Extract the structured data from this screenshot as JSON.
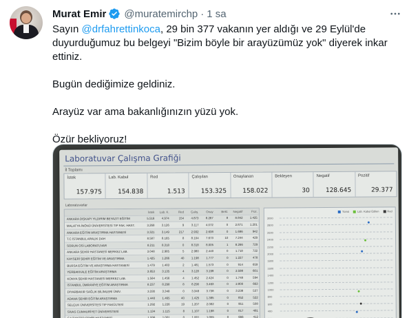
{
  "tweet": {
    "author_name": "Murat Emir",
    "handle": "@muratemirchp",
    "separator": "·",
    "time": "1 sa",
    "icons": {
      "verified": "verified-badge-icon",
      "more": "more-options-icon"
    },
    "colors": {
      "accent": "#1d9bf0",
      "text": "#0f1419",
      "secondary": "#536471"
    },
    "text": {
      "p1_before_mention": "Sayın ",
      "p1_mention": "@drfahrettinkoca",
      "p1_after_mention": ", 29 bin 377 vakanın yer aldığı ve 29 Eylül'de duyurduğumuz bu belgeyi \"Bizim böyle bir arayüzümüz yok\" diyerek inkar ettiniz.",
      "p2": "Bugün dediğimize geldiniz.",
      "p3": "Arayüz var ama bakanlığınızın yüzü yok.",
      "p4": "Özür bekliyoruz!"
    }
  },
  "media": {
    "paper_title": "Laboratuvar Çalışma Grafiği",
    "context_label": "İl Toplamı",
    "kpis": [
      {
        "label": "İstek",
        "value": "157.975"
      },
      {
        "label": "Lab. Kabul",
        "value": "154.838"
      },
      {
        "label": "Red",
        "value": "1.513"
      },
      {
        "label": "Çalışılan",
        "value": "153.325"
      },
      {
        "label": "Onaylanan",
        "value": "158.022"
      },
      {
        "label": "Bekleyen",
        "value": "30"
      },
      {
        "label": "Negatif",
        "value": "128.645"
      },
      {
        "label": "Pozitif",
        "value": "29.377"
      }
    ],
    "table_label": "Laboratuvarlar",
    "table_headers": [
      "",
      "İstek",
      "Lab. K.",
      "Red",
      "Çalış.",
      "Onay",
      "Bekl.",
      "Negatif",
      "Poz."
    ],
    "table_rows": [
      [
        "ANKARA DIŞKAPI YILDIRIM BEYAZIT EĞİTİM",
        "5.516",
        "4.974",
        "154",
        "4.873",
        "8.267",
        "8",
        "8.842",
        "1.425"
      ],
      [
        "MALATYA İNÖNÜ ÜNİVERSİTESİ TIP FAK. HAST.",
        "3.268",
        "3.126",
        "9",
        "3.117",
        "4.072",
        "0",
        "2.871",
        "1.201"
      ],
      [
        "ANKARA EĞİTİM ARAŞTIRMA HASTANESİ",
        "3.321",
        "3.149",
        "217",
        "2.932",
        "2.638",
        "0",
        "1.696",
        "942"
      ],
      [
        "T.C İSTANBUL ARALIK DAH",
        "8.587",
        "8.165",
        "8",
        "8.104",
        "7.673",
        "10",
        "7.244",
        "429"
      ],
      [
        "SORUN OSİ LABORATUVAR",
        "8.211",
        "8.318",
        "0",
        "8.318",
        "8.005",
        "1",
        "8.266",
        "729"
      ],
      [
        "ANKARA ŞEHİR HASTANESİ MERKEZ LAB.",
        "3.048",
        "2.985",
        "5",
        "2.980",
        "2.440",
        "0",
        "1.718",
        "722"
      ],
      [
        "KAYSERİ ŞEHİR EĞİTİM VE ARAŞTIRMA",
        "1.425",
        "1.266",
        "40",
        "1.198",
        "1.777",
        "0",
        "1.227",
        "478"
      ],
      [
        "BURSA EĞİTİM VE ARAŞTIRMA HASTANESİ",
        "1.479",
        "1.483",
        "2",
        "1.481",
        "1.573",
        "0",
        "914",
        "659"
      ],
      [
        "YERBAKKALE EĞİTİM ARAŞTIRMA",
        "3.853",
        "3.135",
        "4",
        "3.128",
        "3.199",
        "0",
        "2.598",
        "601"
      ],
      [
        "KONYA ŞEHİR HASTANESİ MERKEZ LAB.",
        "1.564",
        "1.456",
        "4",
        "1.452",
        "2.424",
        "0",
        "1.748",
        "594"
      ],
      [
        "İSTANBUL ÜMRANİYE EĞİTİM ARAŞTIRMA",
        "8.237",
        "8.298",
        "8",
        "8.290",
        "3.463",
        "0",
        "2.800",
        "663"
      ],
      [
        "DİYARBAKIR SAĞLIK BİLİMLERİ ÜNİV.",
        "3.330",
        "3.348",
        "0",
        "3.348",
        "3.738",
        "0",
        "3.238",
        "537"
      ],
      [
        "ADANA ŞEHİR EĞİTİM ARAŞTIRMA",
        "1.440",
        "1.465",
        "40",
        "1.425",
        "1.385",
        "0",
        "852",
        "522"
      ],
      [
        "SELÇUK ÜNİVERSİTESİ TIP FAKÜLTESİ",
        "1.292",
        "1.226",
        "19",
        "1.207",
        "2.082",
        "0",
        "951",
        "508"
      ],
      [
        "SİVAS CUMHURİYET ÜNİVERSİTESİ",
        "1.134",
        "1.115",
        "8",
        "1.107",
        "1.198",
        "0",
        "817",
        "481"
      ],
      [
        "GAZİANTEP ŞEHİR HASTANESİ",
        "1.006",
        "1.001",
        "0",
        "1.001",
        "1.055",
        "0",
        "666",
        "412"
      ]
    ],
    "chart_legend": [
      "Tümü",
      "Lab. Kabul Edilen",
      "Red"
    ],
    "chart_y_ticks": [
      "3000",
      "2800",
      "2600",
      "2400",
      "2200",
      "2000",
      "1800",
      "1600",
      "1400",
      "1200",
      "1000",
      "800",
      "600",
      "400",
      "200"
    ],
    "chart_colors": {
      "series1": "#2b6cc4",
      "series2": "#6bbf3a",
      "series3": "#3a3a3a"
    }
  }
}
